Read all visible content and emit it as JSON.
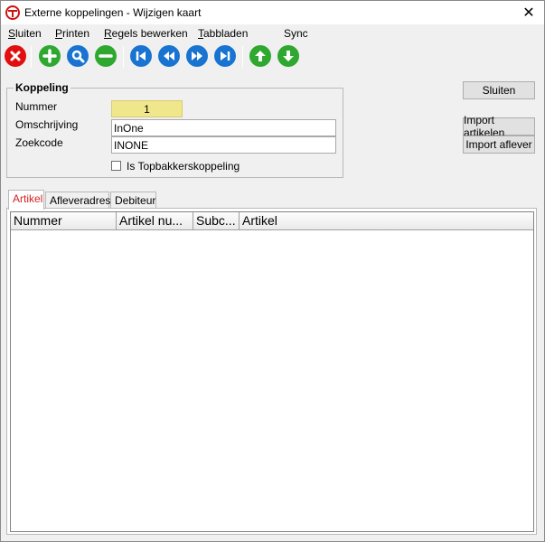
{
  "window": {
    "title": "Externe koppelingen - Wijzigen kaart",
    "close_glyph": "✕"
  },
  "menu": {
    "items": [
      {
        "first": "S",
        "rest": "luiten"
      },
      {
        "first": "P",
        "rest": "rinten"
      },
      {
        "first": "R",
        "rest": "egels bewerken"
      },
      {
        "first": "T",
        "rest": "abbladen"
      },
      {
        "first": "",
        "rest": "Sync"
      }
    ]
  },
  "toolbar": {
    "icons": [
      "close-icon",
      "add-icon",
      "search-icon",
      "remove-icon",
      "first-icon",
      "previous-icon",
      "next-icon",
      "last-icon",
      "up-icon",
      "down-icon"
    ],
    "colors": {
      "red": "#e01010",
      "green": "#2ea82e",
      "blue": "#1874d0"
    }
  },
  "koppeling": {
    "title": "Koppeling",
    "nummer_label": "Nummer",
    "nummer_value": "1",
    "omschrijving_label": "Omschrijving",
    "omschrijving_value": "InOne",
    "zoekcode_label": "Zoekcode",
    "zoekcode_value": "INONE",
    "topbakkers_label": "Is Topbakkerskoppeling",
    "topbakkers_checked": false
  },
  "buttons": {
    "sluiten": "Sluiten",
    "import_artikelen": "Import artikelen",
    "import_aflever": "Import aflever"
  },
  "tabs": [
    {
      "label": "Artikel",
      "active": true
    },
    {
      "label": "Afleveradres",
      "active": false
    },
    {
      "label": "Debiteur",
      "active": false
    }
  ],
  "grid": {
    "columns": [
      "Nummer",
      "Artikel nu...",
      "Subc...",
      "Artikel"
    ],
    "rows": []
  }
}
